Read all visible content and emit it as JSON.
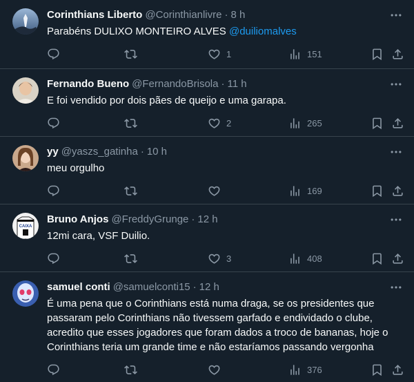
{
  "tweets": [
    {
      "name": "Corinthians Liberto",
      "handle": "@Corinthianlivre",
      "dot": "·",
      "time": "8 h",
      "text": "Parabéns DULIXO MONTEIRO ALVES ",
      "mention": "@duiliomalves",
      "replies": "",
      "retweets": "",
      "likes": "1",
      "views": "151"
    },
    {
      "name": "Fernando Bueno",
      "handle": "@FernandoBrisola",
      "dot": "·",
      "time": "11 h",
      "text": "E foi vendido por dois pães de queijo e uma garapa.",
      "replies": "",
      "retweets": "",
      "likes": "2",
      "views": "265"
    },
    {
      "name": "yy",
      "handle": "@yaszs_gatinha",
      "dot": "·",
      "time": "10 h",
      "text": "meu orgulho",
      "replies": "",
      "retweets": "",
      "likes": "",
      "views": "169"
    },
    {
      "name": "Bruno Anjos",
      "handle": "@FreddyGrunge",
      "dot": "·",
      "time": "12 h",
      "text": "12mi cara, VSF Duilio.",
      "replies": "",
      "retweets": "",
      "likes": "3",
      "views": "408",
      "avatar_text": "CAIXA"
    },
    {
      "name": "samuel conti",
      "handle": "@samuelconti15",
      "dot": "·",
      "time": "12 h",
      "text_lines": [
        "É uma pena que o Corinthians está numa draga, se os presidentes  que",
        "passaram pelo Corinthians não tivessem garfado e endividado o clube,",
        "acredito que esses jogadores que foram dados a troco de bananas, hoje o",
        "Corinthians teria um grande time e não estaríamos passando vergonha"
      ],
      "replies": "",
      "retweets": "",
      "likes": "",
      "views": "376"
    }
  ],
  "colors": {
    "background": "#15202b",
    "text": "#f7f9f9",
    "muted": "#8b98a5",
    "link": "#1d9bf0",
    "divider": "#38444d"
  },
  "icons": [
    "reply-icon",
    "retweet-icon",
    "like-icon",
    "views-icon",
    "bookmark-icon",
    "share-icon",
    "more-icon"
  ]
}
